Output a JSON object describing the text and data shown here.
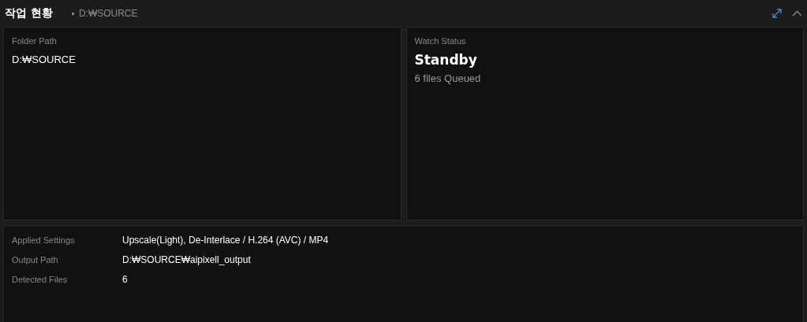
{
  "header": {
    "title": "작업 현황",
    "path": "D:₩SOURCE"
  },
  "cards": [
    {
      "label": "Folder Path",
      "kind": "path",
      "value": "D:₩SOURCE"
    },
    {
      "label": "Watch Status",
      "kind": "status",
      "value": "Standby",
      "detail": "6 files Queued"
    }
  ],
  "settings": [
    {
      "label": "Applied Settings",
      "value": "Upscale(Light), De-Interlace / H.264 (AVC) / MP4"
    },
    {
      "label": "Output Path",
      "value": "D:₩SOURCE₩aipixell_output"
    },
    {
      "label": "Detected Files",
      "value": "6"
    }
  ]
}
